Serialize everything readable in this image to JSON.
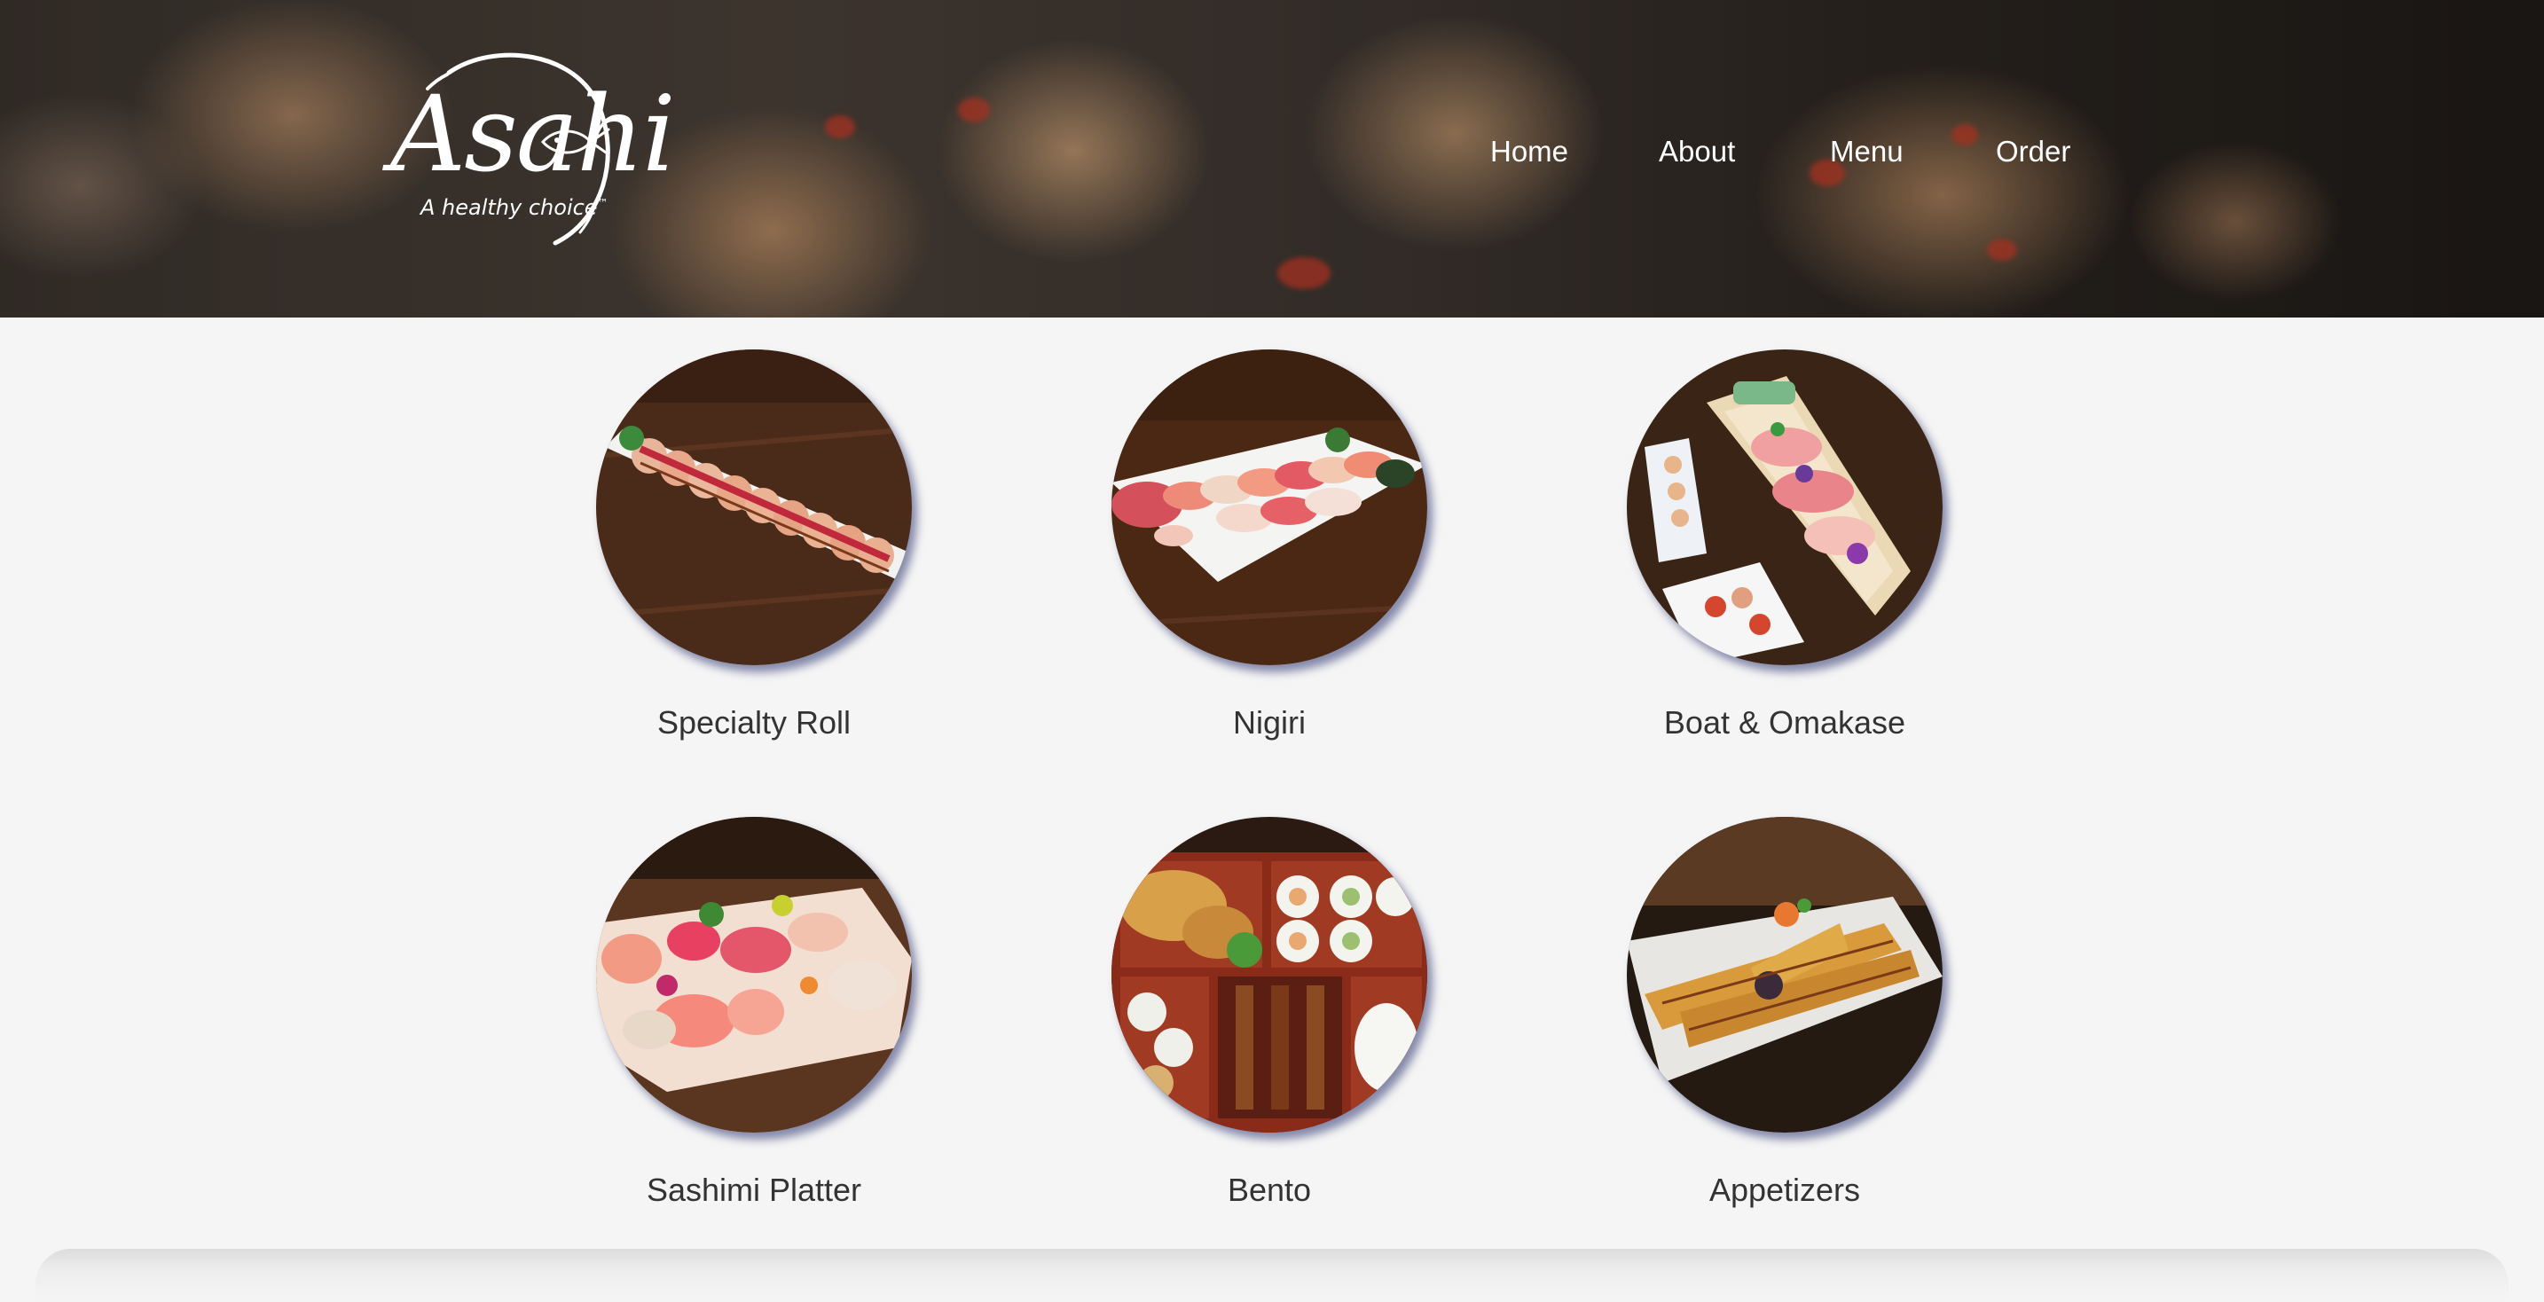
{
  "brand": {
    "name": "Asahi",
    "tagline": "A healthy choice",
    "trademark": "™"
  },
  "nav": {
    "items": [
      {
        "label": "Home"
      },
      {
        "label": "About"
      },
      {
        "label": "Menu"
      },
      {
        "label": "Order"
      }
    ]
  },
  "menu": {
    "categories": [
      {
        "label": "Specialty Roll",
        "image": "specialty-roll-photo"
      },
      {
        "label": "Nigiri",
        "image": "nigiri-photo"
      },
      {
        "label": "Boat & Omakase",
        "image": "boat-omakase-photo"
      },
      {
        "label": "Sashimi Platter",
        "image": "sashimi-platter-photo"
      },
      {
        "label": "Bento",
        "image": "bento-photo"
      },
      {
        "label": "Appetizers",
        "image": "appetizers-photo"
      }
    ]
  },
  "colors": {
    "page_background": "#f5f5f5",
    "nav_text": "#ffffff",
    "label_text": "#333333",
    "image_shadow": "#283270"
  }
}
